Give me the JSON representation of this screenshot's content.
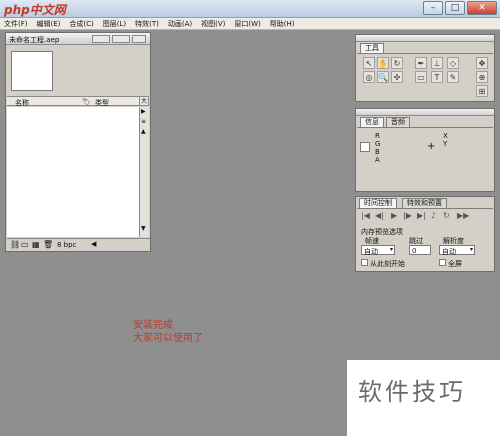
{
  "window": {
    "logo": "php中文网",
    "buttons": [
      "–",
      "□",
      "✕"
    ]
  },
  "menu": [
    "文件(F)",
    "编辑(E)",
    "合成(C)",
    "图层(L)",
    "特效(T)",
    "动画(A)",
    "视图(V)",
    "窗口(W)",
    "帮助(H)"
  ],
  "project": {
    "title": "未命名工程.aep",
    "columns": [
      "名称",
      "类型"
    ],
    "bit_depth": "8 bpc"
  },
  "tools": {
    "title": "工具"
  },
  "info": {
    "tabs": [
      "信息",
      "音频"
    ],
    "channels": [
      "R",
      "G",
      "B",
      "A"
    ],
    "coords": [
      "X",
      "Y"
    ]
  },
  "timecontrol": {
    "tabs": [
      "时间控制",
      "特效和预置"
    ],
    "ram_preview_label": "内存预览选项",
    "frame_rate_label": "帧速",
    "skip_label": "跳过",
    "resolution_label": "解析度",
    "frame_rate_value": "自动",
    "skip_value": "0",
    "resolution_value": "自动",
    "from_current": "从此刻开始",
    "fullscreen": "全屏"
  },
  "message": [
    "安装完成",
    "大家可以使用了"
  ],
  "watermark": "软件技巧"
}
